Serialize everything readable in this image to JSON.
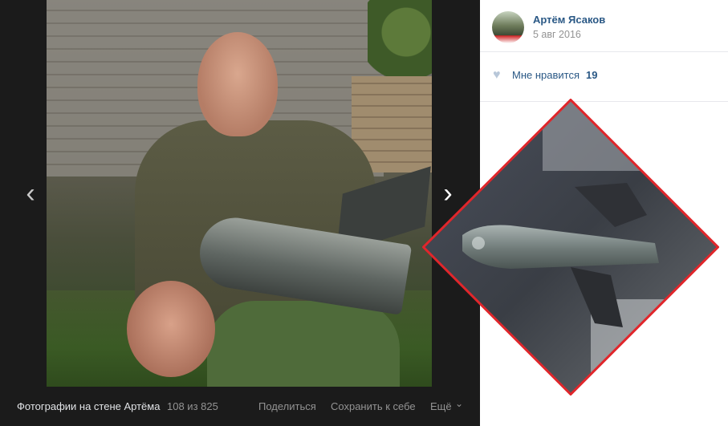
{
  "viewer": {
    "album_label": "Фотографии на стене Артёма",
    "counter": "108 из 825",
    "share_label": "Поделиться",
    "save_label": "Сохранить к себе",
    "more_label": "Ещё",
    "prev_arrow": "‹",
    "next_arrow": "›",
    "more_chevron": "⌄"
  },
  "post": {
    "author_name": "Артём Ясаков",
    "date": "5 авг 2016",
    "like_label": "Мне нравится",
    "like_count": "19",
    "heart_glyph": "♥"
  },
  "icons": {
    "prev": "chevron-left-icon",
    "next": "chevron-right-icon",
    "heart": "heart-icon",
    "more": "chevron-down-icon"
  },
  "colors": {
    "link": "#2a5885",
    "highlight_border": "#e0262b",
    "viewer_bg": "#1b1b1b"
  }
}
